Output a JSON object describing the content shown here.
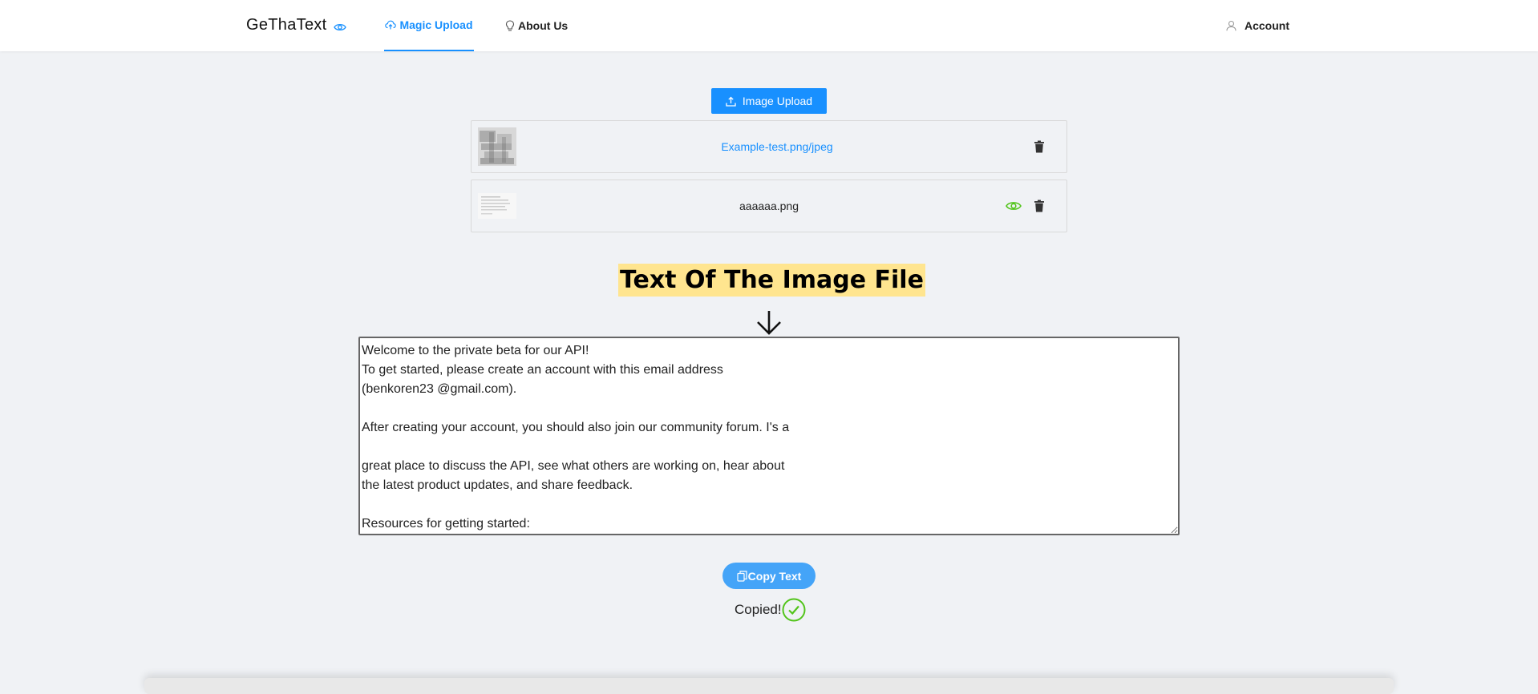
{
  "header": {
    "logo": "GeThaText",
    "nav": [
      {
        "label": "Magic Upload",
        "active": true
      },
      {
        "label": "About Us",
        "active": false
      }
    ],
    "account_label": "Account"
  },
  "upload": {
    "button_label": "Image Upload"
  },
  "files": [
    {
      "name": "Example-test.png/jpeg",
      "has_preview": false
    },
    {
      "name": "aaaaaa.png",
      "has_preview": true
    }
  ],
  "result": {
    "heading": "Text Of The Image File",
    "text": "Welcome to the private beta for our API!\nTo get started, please create an account with this email address\n(benkoren23 @gmail.com).\n\nAfter creating your account, you should also join our community forum. I's a\n\ngreat place to discuss the API, see what others are working on, hear about\nthe latest product updates, and share feedback.\n\nResources for getting started:",
    "copy_label": "Copy Text",
    "copied_label": "Copied!"
  },
  "colors": {
    "primary": "#1890ff",
    "highlight": "#ffe58f",
    "success": "#52c41a",
    "background": "#f0f2f5"
  }
}
